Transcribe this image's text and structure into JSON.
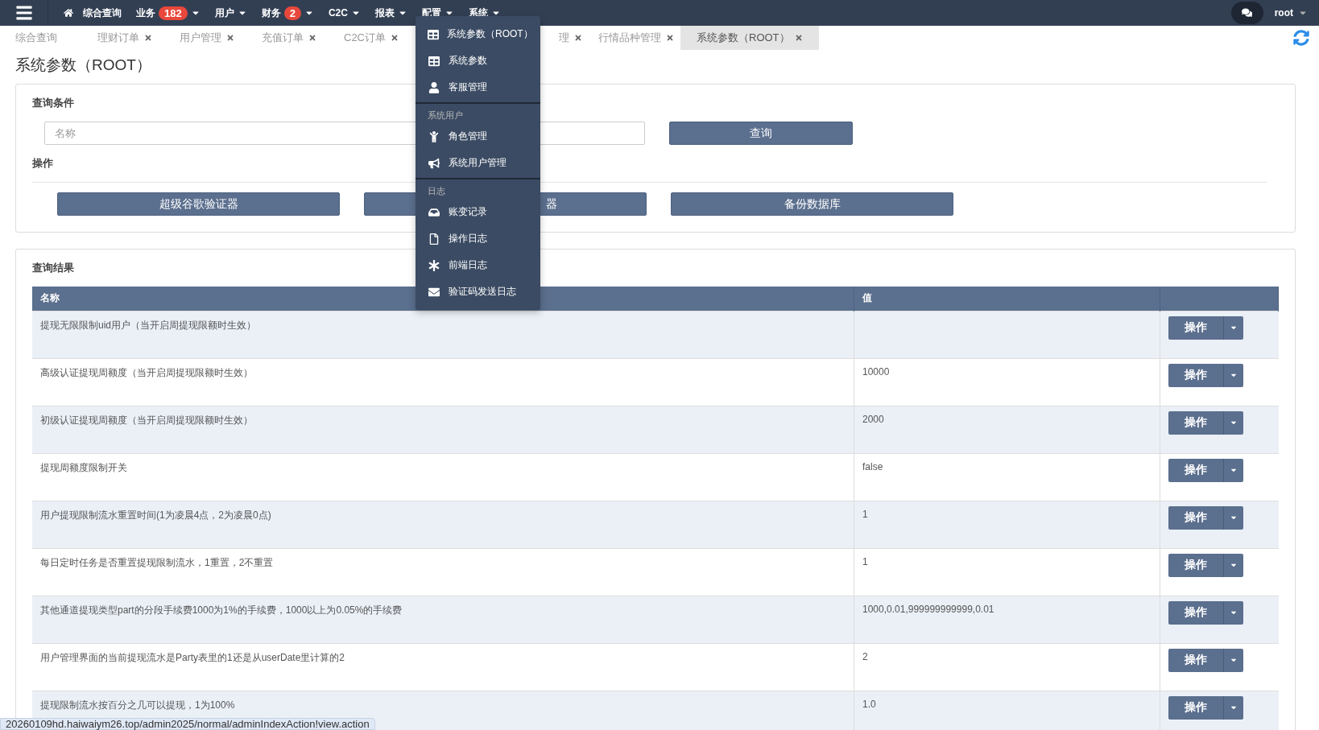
{
  "navbar": {
    "items": [
      {
        "label": "综合查询",
        "kind": "home"
      },
      {
        "label": "业务",
        "badge": "182",
        "kind": "dropdown"
      },
      {
        "label": "用户",
        "kind": "dropdown"
      },
      {
        "label": "财务",
        "badge": "2",
        "kind": "dropdown"
      },
      {
        "label": "C2C",
        "kind": "dropdown"
      },
      {
        "label": "报表",
        "kind": "dropdown"
      },
      {
        "label": "配置",
        "kind": "dropdown"
      },
      {
        "label": "系统",
        "kind": "dropdown"
      }
    ],
    "user": "root"
  },
  "system_menu": {
    "sections": [
      {
        "items": [
          {
            "label": "系统参数（ROOT）"
          },
          {
            "label": "系统参数"
          },
          {
            "label": "客服管理"
          }
        ]
      },
      {
        "header": "系统用户",
        "items": [
          {
            "label": "角色管理"
          },
          {
            "label": "系统用户管理"
          }
        ]
      },
      {
        "header": "日志",
        "items": [
          {
            "label": "账变记录"
          },
          {
            "label": "操作日志"
          },
          {
            "label": "前端日志"
          },
          {
            "label": "验证码发送日志"
          }
        ]
      }
    ]
  },
  "tabs": [
    {
      "label": "综合查询",
      "closable": false,
      "selected": false,
      "kind": "full"
    },
    {
      "label": "理财订单",
      "closable": true,
      "selected": false,
      "kind": "full"
    },
    {
      "label": "用户管理",
      "closable": true,
      "selected": false,
      "kind": "full"
    },
    {
      "label": "充值订单",
      "closable": true,
      "selected": false,
      "kind": "full"
    },
    {
      "label": "C2C订单",
      "closable": true,
      "selected": false,
      "kind": "full"
    },
    {
      "label": "理",
      "closable": true,
      "selected": false,
      "kind": "partial"
    },
    {
      "label": "行情品种管理",
      "closable": true,
      "selected": false,
      "kind": "full"
    },
    {
      "label": "系统参数（ROOT）",
      "closable": true,
      "selected": true,
      "kind": "full"
    }
  ],
  "page_title": "系统参数（ROOT）",
  "query": {
    "title": "查询条件",
    "placeholder": "名称",
    "button": "查询",
    "ops_title": "操作",
    "buttons": [
      {
        "label": "超级谷歌验证器",
        "kind": "full"
      },
      {
        "label": "器",
        "kind": "partial"
      },
      {
        "label": "备份数据库",
        "kind": "full"
      }
    ]
  },
  "results": {
    "title": "查询结果",
    "columns": [
      "名称",
      "值"
    ],
    "rows": [
      {
        "name": "提现无限限制uid用户（当开启周提现限额时生效）",
        "action": "操作"
      },
      {
        "name": "高级认证提现周额度（当开启周提现限额时生效）",
        "value": "10000",
        "action": "操作"
      },
      {
        "name": "初级认证提现周额度（当开启周提现限额时生效）",
        "value": "2000",
        "action": "操作"
      },
      {
        "name": "提现周额度限制开关",
        "value": "false",
        "action": "操作"
      },
      {
        "name": "用户提现限制流水重置时间(1为凌晨4点，2为凌晨0点)",
        "value": "1",
        "action": "操作"
      },
      {
        "name": "每日定时任务是否重置提现限制流水，1重置，2不重置",
        "value": "1",
        "action": "操作"
      },
      {
        "name": "其他通道提现类型part的分段手续费1000为1%的手续费，1000以上为0.05%的手续费",
        "value": "1000,0.01,999999999999,0.01",
        "action": "操作"
      },
      {
        "name": "用户管理界面的当前提现流水是Party表里的1还是从userDate里计算的2",
        "value": "2",
        "action": "操作"
      },
      {
        "name": "提现限制流水按百分之几可以提现，1为100%",
        "value": "1.0",
        "action": "操作"
      }
    ]
  },
  "status_url": "20260109hd.haiwaiym26.top/admin2025/normal/adminIndexAction!view.action"
}
